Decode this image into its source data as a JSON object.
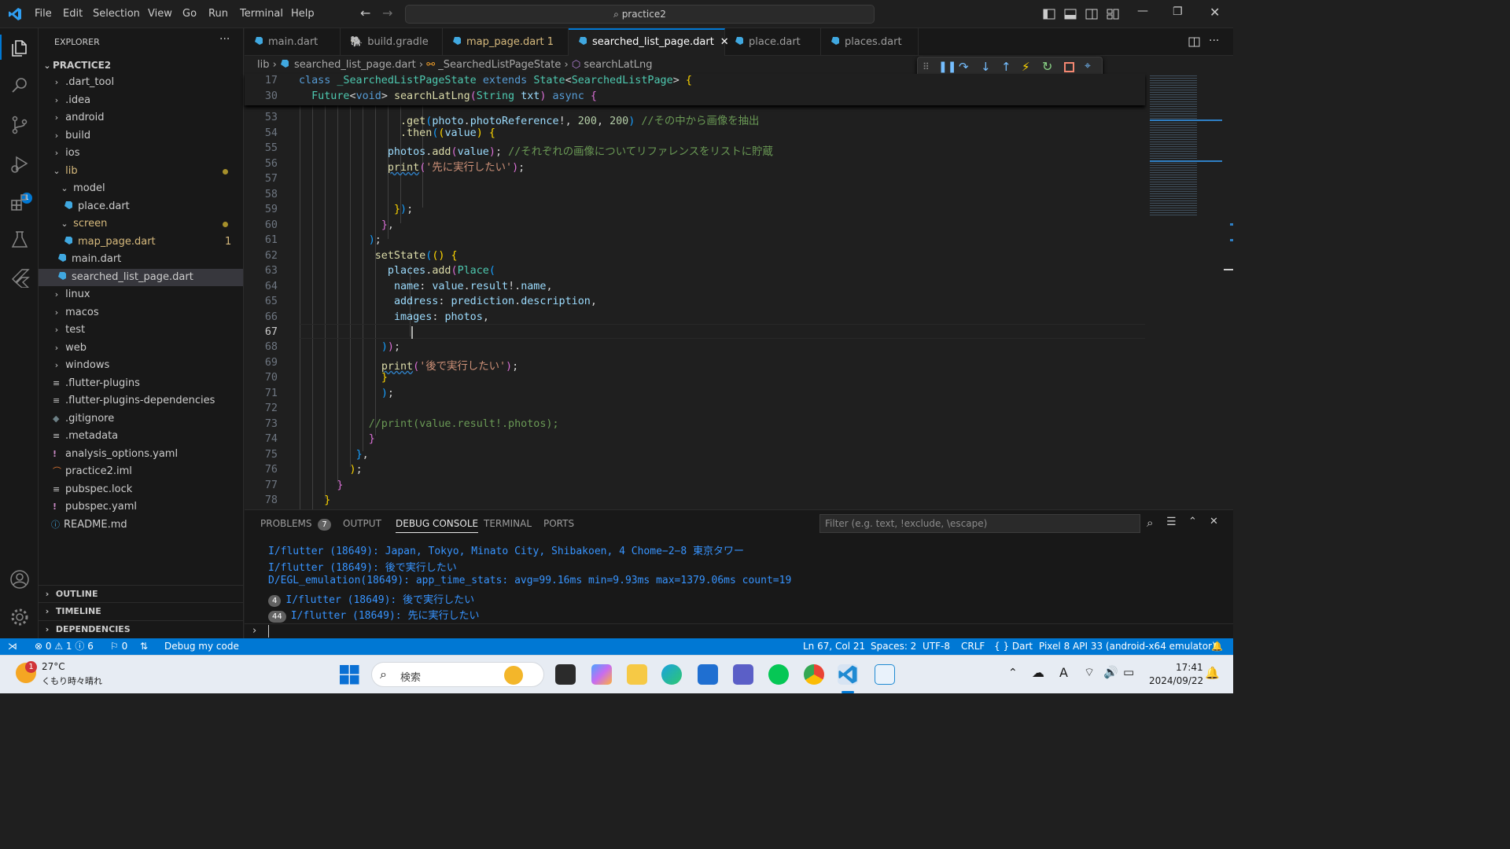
{
  "titlebar": {
    "menu": [
      "File",
      "Edit",
      "Selection",
      "View",
      "Go",
      "Run",
      "Terminal",
      "Help"
    ],
    "search": "practice2"
  },
  "explorer": {
    "header": "EXPLORER",
    "root": "PRACTICE2",
    "items": [
      {
        "label": ".dart_tool",
        "type": "folder"
      },
      {
        "label": ".idea",
        "type": "folder"
      },
      {
        "label": "android",
        "type": "folder"
      },
      {
        "label": "build",
        "type": "folder"
      },
      {
        "label": "ios",
        "type": "folder"
      },
      {
        "label": "lib",
        "type": "folder-open"
      },
      {
        "label": "model",
        "type": "folder-open"
      },
      {
        "label": "place.dart",
        "type": "dart"
      },
      {
        "label": "screen",
        "type": "folder-open"
      },
      {
        "label": "map_page.dart",
        "type": "dart",
        "badge": "1"
      },
      {
        "label": "main.dart",
        "type": "dart"
      },
      {
        "label": "searched_list_page.dart",
        "type": "dart"
      },
      {
        "label": "linux",
        "type": "folder"
      },
      {
        "label": "macos",
        "type": "folder"
      },
      {
        "label": "test",
        "type": "folder"
      },
      {
        "label": "web",
        "type": "folder"
      },
      {
        "label": "windows",
        "type": "folder"
      },
      {
        "label": ".flutter-plugins",
        "type": "file"
      },
      {
        "label": ".flutter-plugins-dependencies",
        "type": "file"
      },
      {
        "label": ".gitignore",
        "type": "file"
      },
      {
        "label": ".metadata",
        "type": "file"
      },
      {
        "label": "analysis_options.yaml",
        "type": "yaml"
      },
      {
        "label": "practice2.iml",
        "type": "file"
      },
      {
        "label": "pubspec.lock",
        "type": "file"
      },
      {
        "label": "pubspec.yaml",
        "type": "yaml"
      },
      {
        "label": "README.md",
        "type": "info"
      }
    ],
    "sections": [
      "OUTLINE",
      "TIMELINE",
      "DEPENDENCIES"
    ]
  },
  "tabs": [
    "main.dart",
    "build.gradle",
    "map_page.dart 1",
    "searched_list_page.dart",
    "place.dart",
    "places.dart"
  ],
  "breadcrumb": {
    "p1": "lib",
    "p2": "searched_list_page.dart",
    "p3": "_SearchedListPageState",
    "p4": "searchLatLng"
  },
  "editor": {
    "sticky": [
      {
        "n": "17",
        "t": "class _SearchedListPageState extends State<SearchedListPage> {"
      },
      {
        "n": "30",
        "t": "  Future<void> searchLatLng(String txt) async {"
      }
    ],
    "lines": [
      {
        "n": "53",
        "t": ".get(photo.photoReference!, 200, 200) //その中から画像を抽出"
      },
      {
        "n": "54",
        "t": ".then((value) {"
      },
      {
        "n": "55",
        "t": "photos.add(value); //それぞれの画像についてリファレンスをリストに貯蔵"
      },
      {
        "n": "56",
        "t": "print('先に実行したい');"
      },
      {
        "n": "57",
        "t": ""
      },
      {
        "n": "58",
        "t": ""
      },
      {
        "n": "59",
        "t": "});"
      },
      {
        "n": "60",
        "t": "},"
      },
      {
        "n": "61",
        "t": ");"
      },
      {
        "n": "62",
        "t": "setState(() {"
      },
      {
        "n": "63",
        "t": "places.add(Place("
      },
      {
        "n": "64",
        "t": "name: value.result!.name,"
      },
      {
        "n": "65",
        "t": "address: prediction.description,"
      },
      {
        "n": "66",
        "t": "images: photos,"
      },
      {
        "n": "67",
        "t": ""
      },
      {
        "n": "68",
        "t": "));"
      },
      {
        "n": "69",
        "t": "print('後で実行したい');"
      },
      {
        "n": "70",
        "t": "}"
      },
      {
        "n": "71",
        "t": ");"
      },
      {
        "n": "72",
        "t": ""
      },
      {
        "n": "73",
        "t": "//print(value.result!.photos);"
      },
      {
        "n": "74",
        "t": "}"
      },
      {
        "n": "75",
        "t": "},"
      },
      {
        "n": "76",
        "t": ");"
      },
      {
        "n": "77",
        "t": "}"
      },
      {
        "n": "78",
        "t": "}"
      }
    ]
  },
  "panel": {
    "tabs": {
      "problems": "PROBLEMS",
      "problems_count": "7",
      "output": "OUTPUT",
      "debug": "DEBUG CONSOLE",
      "terminal": "TERMINAL",
      "ports": "PORTS"
    },
    "filter_placeholder": "Filter (e.g. text, !exclude, \\escape)",
    "console": [
      {
        "count": "",
        "text": "I/flutter (18649): Japan, Tokyo, Minato City, Shibakoen, 4 Chome−2−8 東京タワー"
      },
      {
        "count": "",
        "text": "I/flutter (18649): 後で実行したい"
      },
      {
        "count": "",
        "text": "D/EGL_emulation(18649): app_time_stats: avg=99.16ms min=9.93ms max=1379.06ms count=19"
      },
      {
        "count": "4",
        "text": "I/flutter (18649): 後で実行したい"
      },
      {
        "count": "44",
        "text": "I/flutter (18649): 先に実行したい"
      }
    ]
  },
  "statusbar": {
    "errors": "0",
    "warnings": "1",
    "infos": "6",
    "ports": "0",
    "debug": "Debug my code",
    "position": "Ln 67, Col 21",
    "spaces": "Spaces: 2",
    "encoding": "UTF-8",
    "eol": "CRLF",
    "lang": "Dart",
    "device": "Pixel 8 API 33 (android-x64 emulator)"
  },
  "taskbar": {
    "temp": "27°C",
    "weather": "くもり時々晴れ",
    "weather_badge": "1",
    "search": "検索",
    "time": "17:41",
    "date": "2024/09/22"
  },
  "colors": {
    "accent": "#0078d4",
    "statusbar": "#0078d4",
    "tab_active_border": "#0078d4"
  }
}
